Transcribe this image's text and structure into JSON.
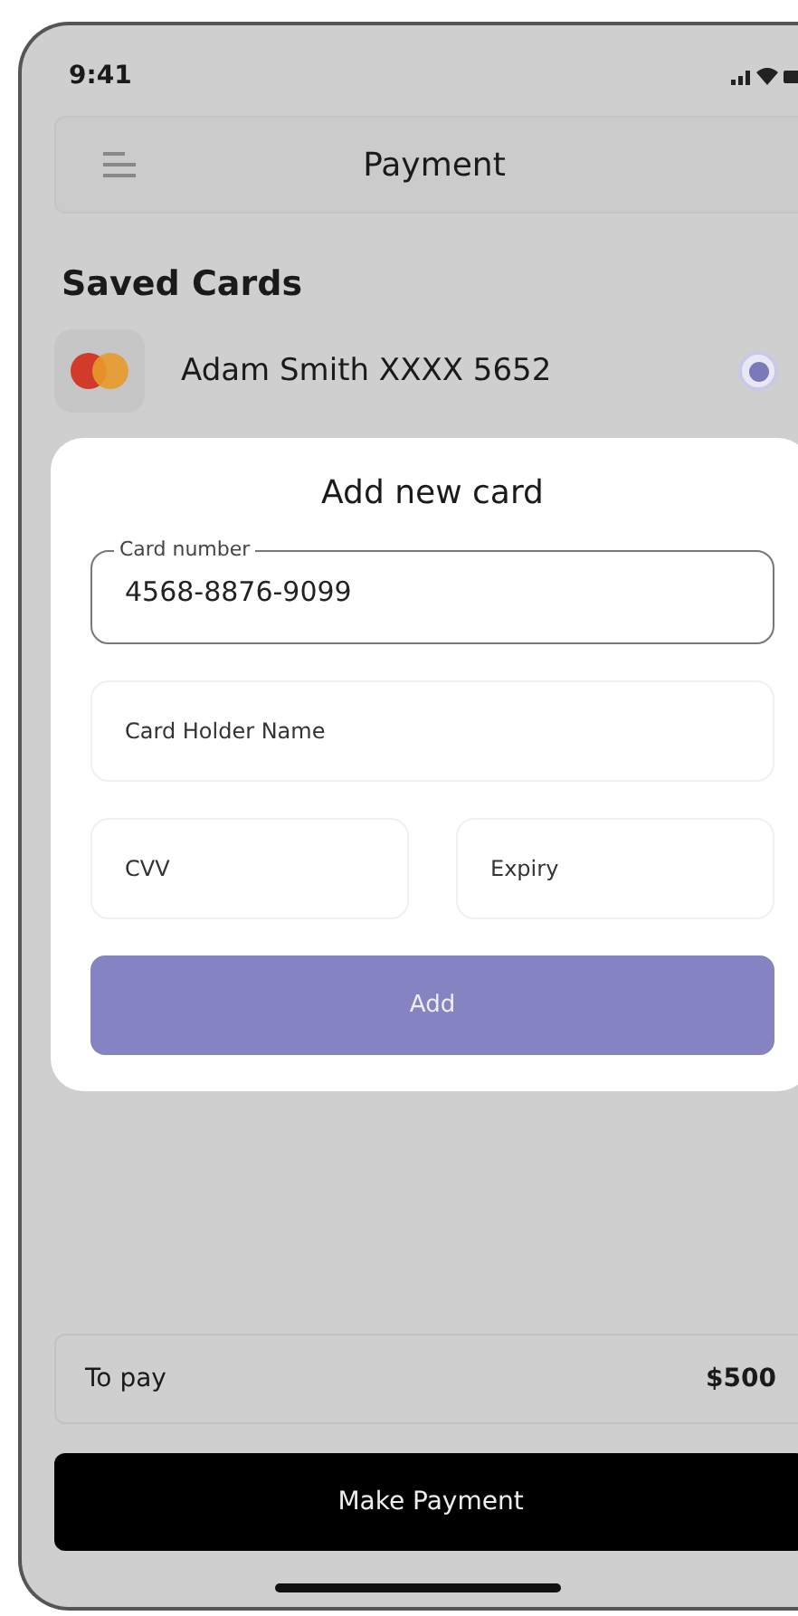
{
  "status_bar": {
    "time": "9:41"
  },
  "header": {
    "title": "Payment"
  },
  "saved_cards": {
    "heading": "Saved Cards",
    "items": [
      {
        "label": "Adam  Smith XXXX 5652",
        "selected": true
      }
    ]
  },
  "add_card": {
    "title": "Add new card",
    "card_number": {
      "label": "Card number",
      "value": "4568-8876-9099"
    },
    "holder": {
      "placeholder": "Card Holder Name"
    },
    "cvv": {
      "placeholder": "CVV"
    },
    "expiry": {
      "placeholder": "Expiry"
    },
    "button": "Add"
  },
  "total": {
    "label": "To pay",
    "amount": "$500"
  },
  "pay_button": "Make Payment"
}
